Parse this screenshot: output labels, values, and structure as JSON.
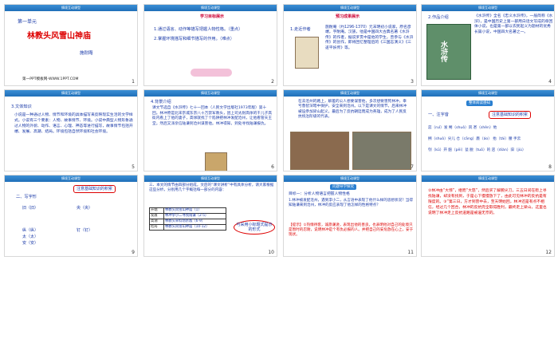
{
  "header_label": "情境互动课型",
  "slides": [
    {
      "num": "1",
      "title": "第一单元",
      "headline": "林教头风雪山神庙",
      "author": "施耐庵",
      "footer": "第一PPT模板网-WWW.1PPT.COM"
    },
    {
      "num": "2",
      "tag": "学习目标展示",
      "items": [
        "1.通过语言、动作等描写把握人物性格。（重点）",
        "2.掌握环境描写和细节描写的作用。（难点）"
      ]
    },
    {
      "num": "3",
      "tag": "预习成果展示",
      "label": "1.走近作者",
      "bio": "施耐庵（约1296-1370）元末明初小说家，原名彦端，字耐庵。汉族，他是中国四大古典名著《水浒传》的作者，据说罗贯中是他的学生，曾参与《水浒传》的创作，即将回忆整理后的《三国志演义》《三遂平妖传》等。"
    },
    {
      "num": "4",
      "label": "2.作品介绍",
      "intro": "《水浒传》全名《忠义水浒传》，一般简称《水浒》，是中国历史上第一部用白话文写成的章回体小说，也是第一部以农民起义为题材的优秀长篇小说，中国四大名著之一。",
      "book": "水浒传"
    },
    {
      "num": "5",
      "label": "3.文体知识",
      "text": "小说是一种通过人物、情节和环境的具体描写来反映现实生活的文学样式。小说有三个要素：人物、故事情节、环境。小说中典型人物形象通过人物的外貌、动作、语言、心理、神态等进行描写，故事情节包括开端、发展、高潮、结局。环境包括自然环境和社会环境。"
    },
    {
      "num": "6",
      "label": "4.背景介绍",
      "text": "课文节选自《水浒传》七十一回本（人民文学出版社1973年版）第十回。林冲原是北宋京城东京八十万禁军教头，因上司太尉高俅的干儿子高衙内看上了他的妻子，高俅就找了个陷阱把林冲发配沧州，让他看管天王堂。然后又派亲信陆谦到沧州谋害他。林冲得知，到处寻找陆谦报仇。"
    },
    {
      "num": "7",
      "text": "在去沧州的路上，解差的公人想要谋害他，多次想要害死林冲，幸亏鲁智深暗中保护，安全来到沧州。以下是课文的情节，后来林冲被迫参加梁山起义，最后为了反抗朝廷而成为英雄，成为了人民反抗统治阶级的代表。",
      "caption": "林冲"
    },
    {
      "num": "8",
      "pill": "整体阅读感知",
      "label": "一、注字音",
      "callout": "注意基础知识的积累",
      "lines": [
        "蕊（ruǐ）发 朔（shuò）风 甚（shèn）地",
        "搠（shuò）尖儿 仓（cāng）廒（áo） 抬（tái）腰 手云",
        "刳（kū）开 醅（pēi）瓮 脱（tuō）的 店（diàn）旧（jiù）"
      ]
    },
    {
      "num": "9",
      "label": "二、写字形",
      "callout": "注意基础知识的积累",
      "lines": [
        "旧（旧）",
        "央（央）",
        "纵（纵）",
        "太（太）",
        "安（安）",
        "钉（钉）"
      ]
    },
    {
      "num": "10",
      "label": "三、本文的情节由四部分组成，文后的“课文讲析”中有具体分析，请大家根据这些分析，分别用几个字概括每一部分的内容：",
      "rows": [
        {
          "part": "开端",
          "title": "林教头风雪山神庙（1）"
        },
        {
          "part": "发展",
          "title": "林冲李小二寻找陆谦（2-5）"
        },
        {
          "part": "高潮",
          "title": "林教头草料场杀敌（6-9）"
        },
        {
          "part": "结局",
          "title": "林教头风雪山神庙（10-12）"
        }
      ],
      "callout": "可采用小标题式提示的形式"
    },
    {
      "num": "11",
      "pill": "问题导学探究",
      "label": "目标一：分析人物语言把握人物性格",
      "q": "1.林冲被发配沧州，遇到李小二，从言语中表现了他什么样的思想状况？当得知陆谦来到沧州，林冲的反应表现了他怎样的性格特点？",
      "hint": "【提示】①热情待客，诚恳谦逊，表现出他的善良，也表明他对自己的处境只是暂时的忍耐，说明林冲是个有仇必报的人。并把自己的安危放在心上，安于现状。"
    },
    {
      "num": "12",
      "text": "②林冲由“大惊”，继而“大怒”，然后买了解腕尖刀，三五日间在街上寻找陆谦，却没有找到，于是心下慢慢放下了，由此可见林冲的反抗是有限度的。③“第三日，方才到营中去，至天明始回，林冲还是有点不相信，经过几个回合，林冲的反抗完全取得胜利，最终走上梁山，这里也说明了林冲走上反抗道路是被逼无奈的。"
    }
  ]
}
